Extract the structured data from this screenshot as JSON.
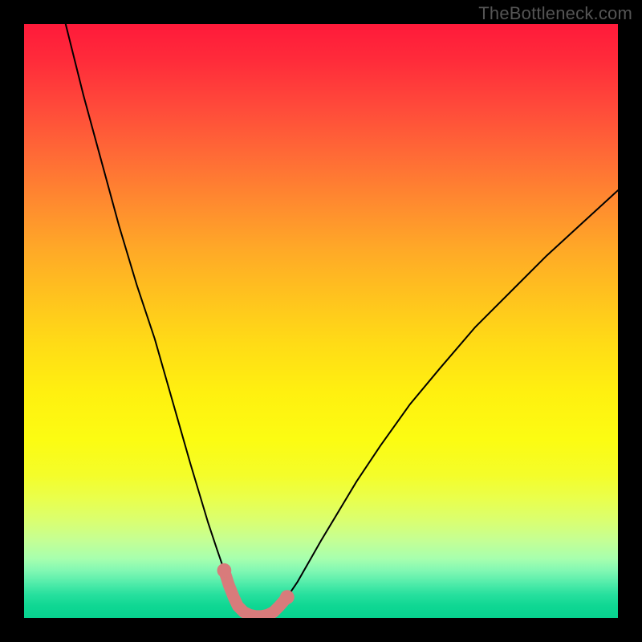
{
  "watermark": "TheBottleneck.com",
  "chart_data": {
    "type": "line",
    "title": "",
    "xlabel": "",
    "ylabel": "",
    "xlim": [
      0,
      100
    ],
    "ylim": [
      0,
      100
    ],
    "grid": false,
    "legend": false,
    "series": [
      {
        "name": "curve",
        "stroke": "#000000",
        "x": [
          7,
          10,
          13,
          16,
          19,
          22,
          24,
          26,
          28,
          29.5,
          31,
          32.5,
          33.7,
          34.5,
          35.3,
          36,
          37,
          38,
          39,
          40,
          41,
          42,
          43,
          44.3,
          46,
          48,
          50,
          53,
          56,
          60,
          65,
          70,
          76,
          82,
          88,
          94,
          100
        ],
        "y": [
          100,
          88,
          77,
          66,
          56,
          47,
          40,
          33,
          26,
          21,
          16,
          11.5,
          8,
          5.5,
          3.5,
          2,
          1,
          0.5,
          0.3,
          0.3,
          0.5,
          1,
          2,
          3.5,
          6,
          9.5,
          13,
          18,
          23,
          29,
          36,
          42,
          49,
          55,
          61,
          66.5,
          72
        ]
      }
    ],
    "markers": [
      {
        "name": "min-region-left-end",
        "x": 33.7,
        "y": 8,
        "r": 1.2,
        "color": "#d87b7b"
      },
      {
        "name": "min-region-right-end",
        "x": 44.3,
        "y": 3.5,
        "r": 1.2,
        "color": "#d87b7b"
      }
    ],
    "highlight": {
      "name": "min-region-band",
      "x_start": 33.7,
      "x_end": 44.3,
      "stroke": "#d87b7b",
      "stroke_width_pct": 2.0
    },
    "background": {
      "type": "vertical-gradient",
      "stops": [
        {
          "pos": 0.0,
          "color": "#ff1a3a"
        },
        {
          "pos": 0.5,
          "color": "#ffdc16"
        },
        {
          "pos": 0.78,
          "color": "#f4fd2a"
        },
        {
          "pos": 0.9,
          "color": "#a7ffae"
        },
        {
          "pos": 1.0,
          "color": "#07d28f"
        }
      ]
    }
  }
}
